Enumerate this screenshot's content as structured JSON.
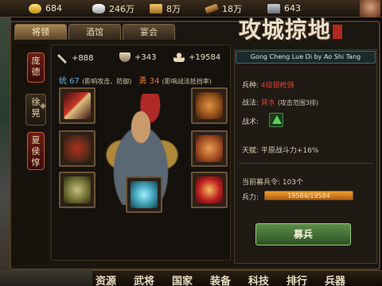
{
  "resources": [
    {
      "icon": "gold-icon",
      "value": "684"
    },
    {
      "icon": "silver-icon",
      "value": "246万"
    },
    {
      "icon": "food-icon",
      "value": "8万"
    },
    {
      "icon": "wood-icon",
      "value": "18万"
    },
    {
      "icon": "iron-icon",
      "value": "643"
    }
  ],
  "tabs": [
    "将领",
    "酒馆",
    "宴会"
  ],
  "game_title": "攻城掠地",
  "generals": [
    "庞德",
    "徐晃",
    "夏侯惇"
  ],
  "stats": {
    "attack": "+888",
    "defense": "+343",
    "troops": "+19584"
  },
  "sub_stats": {
    "leadership_label": "统 67",
    "leadership_desc": "(影响攻击、防御)",
    "courage_label": "勇 34",
    "courage_desc": "(影响战法抵挡率)"
  },
  "info": {
    "header": "Gong Cheng Lue Di by Ao Shi Tang",
    "troop_type_label": "兵种:",
    "troop_type_value": "4级银枪骑",
    "tactic_label": "战法:",
    "tactic_value": "背水",
    "tactic_desc": "(攻击范围3排)",
    "tactic_item_label": "战术:",
    "talent_label": "天赋:",
    "talent_value": "平原战斗力+16%",
    "recruit_order_label": "当前募兵令:",
    "recruit_order_value": "103个",
    "troop_power_label": "兵力:",
    "troop_power_text": "19584/19584",
    "troop_power_fraction": 1.0,
    "recruit_button": "募兵"
  },
  "bottom_nav": [
    "资源",
    "武将",
    "国家",
    "装备",
    "科技",
    "排行",
    "兵器"
  ],
  "colors": {
    "leadership": "#5fb0e8",
    "courage": "#e07a2a",
    "highlight": "#e0402a",
    "recruit_button": "#4a7a3a"
  }
}
